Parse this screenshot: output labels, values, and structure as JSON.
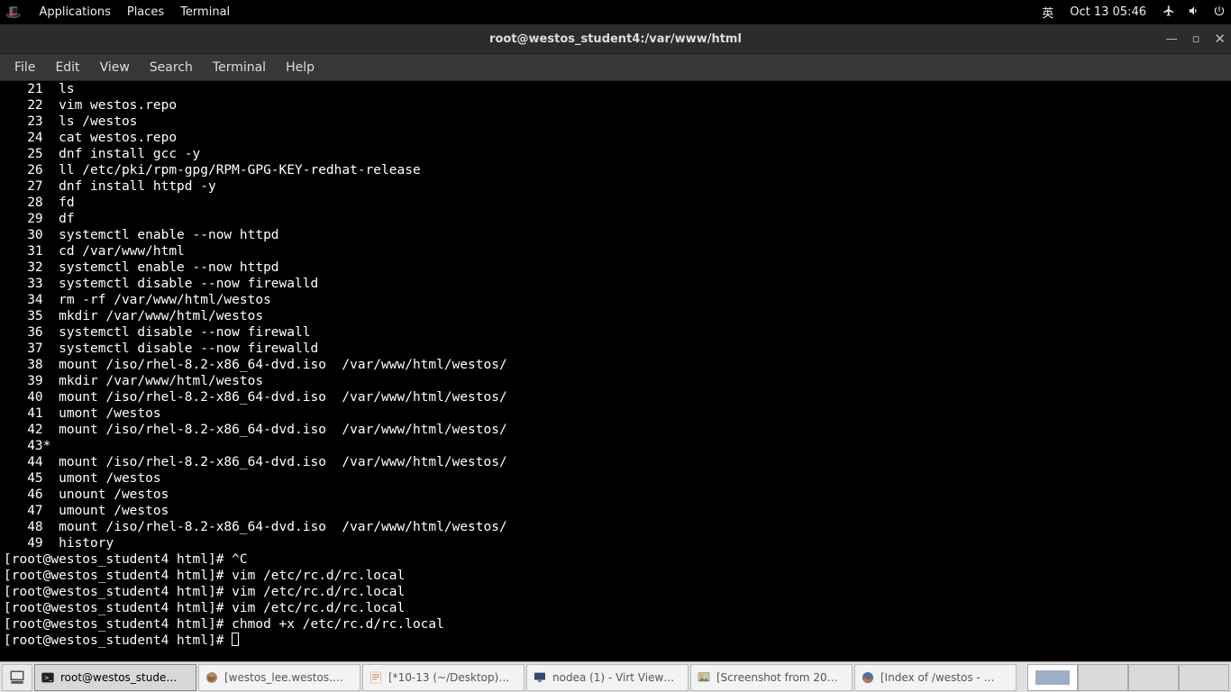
{
  "topbar": {
    "apps": "Applications",
    "places": "Places",
    "terminal": "Terminal",
    "ime": "英",
    "clock": "Oct 13  05:46"
  },
  "window": {
    "title": "root@westos_student4:/var/www/html"
  },
  "menu": {
    "file": "File",
    "edit": "Edit",
    "view": "View",
    "search": "Search",
    "terminal": "Terminal",
    "help": "Help"
  },
  "terminal": {
    "history": [
      {
        "n": "21",
        "cmd": "ls"
      },
      {
        "n": "22",
        "cmd": "vim westos.repo"
      },
      {
        "n": "23",
        "cmd": "ls /westos"
      },
      {
        "n": "24",
        "cmd": "cat westos.repo"
      },
      {
        "n": "25",
        "cmd": "dnf install gcc -y"
      },
      {
        "n": "26",
        "cmd": "ll /etc/pki/rpm-gpg/RPM-GPG-KEY-redhat-release"
      },
      {
        "n": "27",
        "cmd": "dnf install httpd -y"
      },
      {
        "n": "28",
        "cmd": "fd"
      },
      {
        "n": "29",
        "cmd": "df"
      },
      {
        "n": "30",
        "cmd": "systemctl enable --now httpd"
      },
      {
        "n": "31",
        "cmd": "cd /var/www/html"
      },
      {
        "n": "32",
        "cmd": "systemctl enable --now httpd"
      },
      {
        "n": "33",
        "cmd": "systemctl disable --now firewalld"
      },
      {
        "n": "34",
        "cmd": "rm -rf /var/www/html/westos"
      },
      {
        "n": "35",
        "cmd": "mkdir /var/www/html/westos"
      },
      {
        "n": "36",
        "cmd": "systemctl disable --now firewall"
      },
      {
        "n": "37",
        "cmd": "systemctl disable --now firewalld"
      },
      {
        "n": "38",
        "cmd": "mount /iso/rhel-8.2-x86_64-dvd.iso  /var/www/html/westos/"
      },
      {
        "n": "39",
        "cmd": "mkdir /var/www/html/westos"
      },
      {
        "n": "40",
        "cmd": "mount /iso/rhel-8.2-x86_64-dvd.iso  /var/www/html/westos/"
      },
      {
        "n": "41",
        "cmd": "umont /westos"
      },
      {
        "n": "42",
        "cmd": "mount /iso/rhel-8.2-x86_64-dvd.iso  /var/www/html/westos/"
      }
    ],
    "history_marker": "   43*",
    "history_tail": [
      {
        "n": "44",
        "cmd": "mount /iso/rhel-8.2-x86_64-dvd.iso  /var/www/html/westos/"
      },
      {
        "n": "45",
        "cmd": "umont /westos"
      },
      {
        "n": "46",
        "cmd": "unount /westos"
      },
      {
        "n": "47",
        "cmd": "umount /westos"
      },
      {
        "n": "48",
        "cmd": "mount /iso/rhel-8.2-x86_64-dvd.iso  /var/www/html/westos/"
      },
      {
        "n": "49",
        "cmd": "history"
      }
    ],
    "prompts": [
      "[root@westos_student4 html]# ^C",
      "[root@westos_student4 html]# vim /etc/rc.d/rc.local",
      "[root@westos_student4 html]# vim /etc/rc.d/rc.local",
      "[root@westos_student4 html]# vim /etc/rc.d/rc.local",
      "[root@westos_student4 html]# chmod +x /etc/rc.d/rc.local"
    ],
    "current_prompt": "[root@westos_student4 html]# "
  },
  "taskbar": {
    "items": [
      {
        "label": "root@westos_stude…",
        "active": true,
        "icon": "terminal"
      },
      {
        "label": "[westos_lee.westos.…",
        "active": false,
        "icon": "firefox-alt"
      },
      {
        "label": "[*10-13 (~/Desktop)…",
        "active": false,
        "icon": "gedit"
      },
      {
        "label": "nodea (1) - Virt View…",
        "active": false,
        "icon": "virt"
      },
      {
        "label": "[Screenshot from 20…",
        "active": false,
        "icon": "image"
      },
      {
        "label": "[Index of /westos - …",
        "active": false,
        "icon": "firefox"
      }
    ]
  }
}
